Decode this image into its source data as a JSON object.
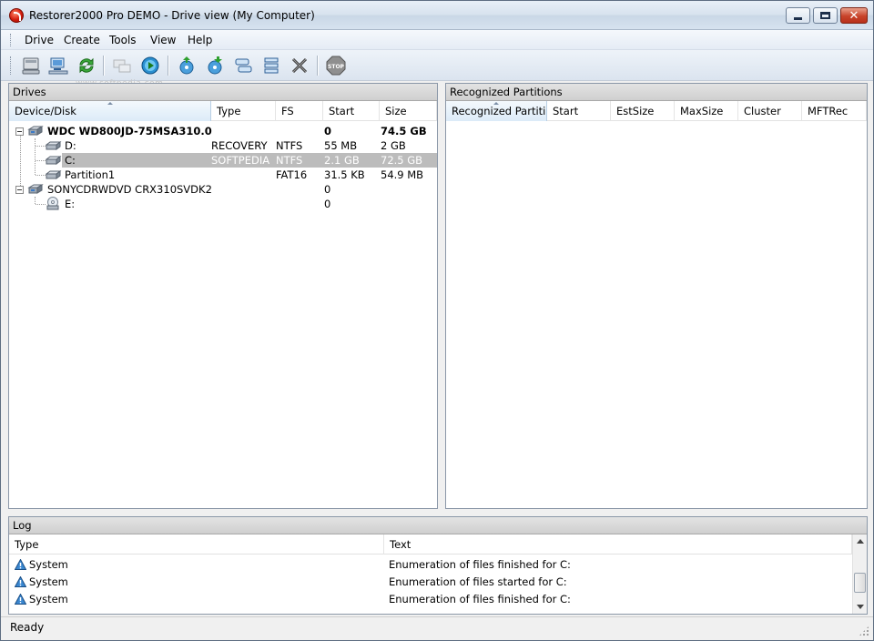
{
  "window": {
    "title": "Restorer2000 Pro DEMO - Drive view (My Computer)"
  },
  "menu": [
    "Drive",
    "Create",
    "Tools",
    "View",
    "Help"
  ],
  "toolbar": {
    "icons": [
      "drive-icon",
      "network-drive-icon",
      "refresh-icon",
      "copy-icon",
      "scan-icon",
      "open-image-icon",
      "save-image-icon",
      "create-region-icon",
      "create-raid-icon",
      "delete-icon",
      "stop-icon"
    ],
    "watermark": "www.softpedia.com"
  },
  "drives": {
    "title": "Drives",
    "columns": [
      "Device/Disk",
      "Type",
      "FS",
      "Start",
      "Size"
    ],
    "rows": [
      {
        "name": "WDC WD800JD-75MSA310.0",
        "type": "",
        "fs": "",
        "start": "0",
        "size": "74.5 GB"
      },
      {
        "name": "D:",
        "type": "RECOVERY",
        "fs": "NTFS",
        "start": "55 MB",
        "size": "2 GB"
      },
      {
        "name": "C:",
        "type": "SOFTPEDIA",
        "fs": "NTFS",
        "start": "2.1 GB",
        "size": "72.5 GB"
      },
      {
        "name": "Partition1",
        "type": "",
        "fs": "FAT16",
        "start": "31.5 KB",
        "size": "54.9 MB"
      },
      {
        "name": "SONYCDRWDVD CRX310SVDK2",
        "type": "",
        "fs": "",
        "start": "0",
        "size": ""
      },
      {
        "name": "E:",
        "type": "",
        "fs": "",
        "start": "0",
        "size": ""
      }
    ]
  },
  "partitions": {
    "title": "Recognized Partitions",
    "columns": [
      "Recognized Partiti...",
      "Start",
      "EstSize",
      "MaxSize",
      "Cluster",
      "MFTRec"
    ]
  },
  "log": {
    "title": "Log",
    "columns": [
      "Type",
      "Text"
    ],
    "rows": [
      {
        "type": "System",
        "text": "Enumeration of files finished for C:"
      },
      {
        "type": "System",
        "text": "Enumeration of files started for C:"
      },
      {
        "type": "System",
        "text": "Enumeration of files finished for C:"
      }
    ]
  },
  "status": "Ready",
  "colors": {
    "selection": "#bcbcbc",
    "accent": "#2f86c6"
  }
}
